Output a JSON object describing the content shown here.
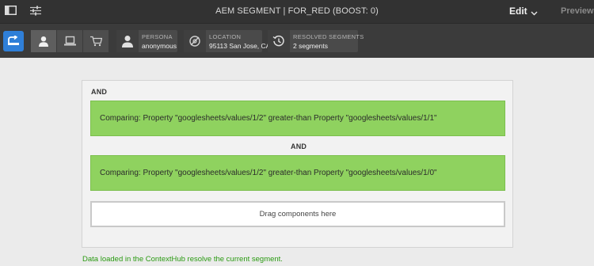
{
  "header": {
    "title": "AEM SEGMENT | FOR_RED (BOOST: 0)",
    "edit_label": "Edit",
    "preview_label": "Preview"
  },
  "toolbar": {
    "persona": {
      "label": "PERSONA",
      "value": "anonymous"
    },
    "location": {
      "label": "LOCATION",
      "value": "95113 San Jose, CA"
    },
    "resolved": {
      "label": "RESOLVED SEGMENTS",
      "value": "2 segments"
    }
  },
  "segment": {
    "root_operator": "AND",
    "conditions": [
      "Comparing: Property \"googlesheets/values/1/2\" greater-than Property \"googlesheets/values/1/1\"",
      "Comparing: Property \"googlesheets/values/1/2\" greater-than Property \"googlesheets/values/1/0\""
    ],
    "inner_operator": "AND",
    "dropzone_text": "Drag components here"
  },
  "status_message": "Data loaded in the ContextHub resolve the current segment.",
  "colors": {
    "condition_bg": "#8fd25f",
    "hub_blue": "#2f7fd8",
    "status_green": "#2a9a12"
  }
}
